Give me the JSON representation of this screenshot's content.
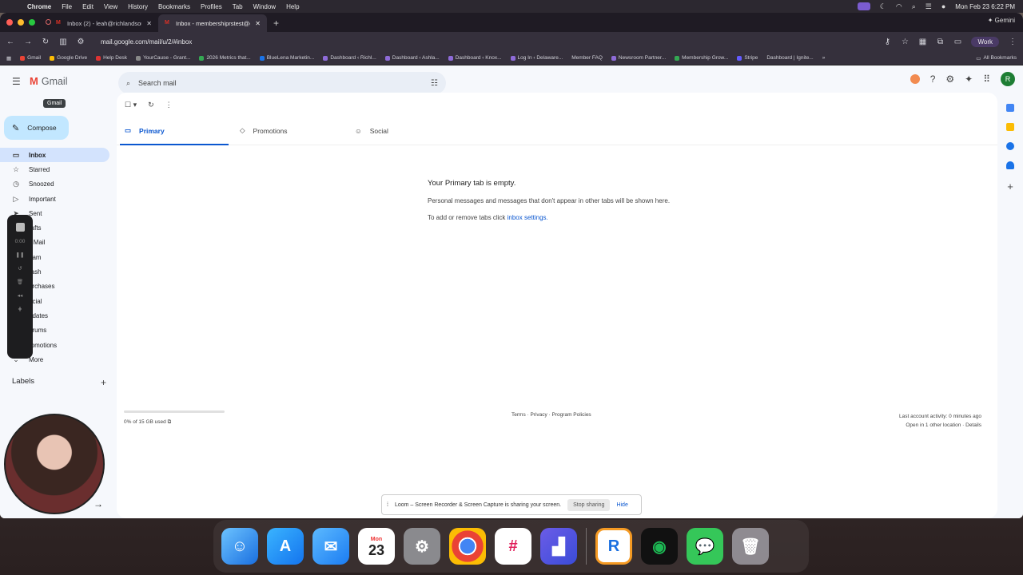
{
  "menubar": {
    "app": "Chrome",
    "menus": [
      "File",
      "Edit",
      "View",
      "History",
      "Bookmarks",
      "Profiles",
      "Tab",
      "Window",
      "Help"
    ],
    "clock": "Mon Feb 23  6:22 PM"
  },
  "browser": {
    "tabs": [
      {
        "title": "Inbox (2) - leah@richlandsou..."
      },
      {
        "title": "Inbox - membershiprstest@g..."
      }
    ],
    "gemini": "Gemini",
    "url": "mail.google.com/mail/u/2/#inbox",
    "profile": "Work",
    "bookmarks": [
      "Gmail",
      "Google Drive",
      "Help Desk",
      "YourCause - Grant...",
      "2026 Metrics that...",
      "BlueLena Marketin...",
      "Dashboard ‹ Richl...",
      "Dashboard ‹ Ashla...",
      "Dashboard ‹ Knox...",
      "Log In ‹ Delaware...",
      "Member FAQ",
      "Newsroom Partner...",
      "Membership Grow...",
      "Stripe",
      "Dashboard | Ignite..."
    ],
    "all_bookmarks": "All Bookmarks"
  },
  "gmail": {
    "logo": "Gmail",
    "tooltip": "Gmail",
    "search_placeholder": "Search mail",
    "compose": "Compose",
    "nav": [
      "Inbox",
      "Starred",
      "Snoozed",
      "Important",
      "Sent",
      "Drafts",
      "All Mail",
      "Spam",
      "Trash",
      "Purchases",
      "Social",
      "Updates",
      "Forums",
      "Promotions",
      "More"
    ],
    "nav_visible": [
      "Inbox",
      "Starred",
      "Snoozed",
      "Important",
      "Sent",
      "rafts",
      "ll Mail",
      "pam",
      "rash",
      "urchases",
      "ocial",
      "pdates",
      "orums",
      "romotions",
      "More"
    ],
    "labels_title": "Labels",
    "loom_timer": "0:00",
    "avatar_letter": "R",
    "tabs": [
      "Primary",
      "Promotions",
      "Social"
    ],
    "empty_title": "Your Primary tab is empty.",
    "empty_body": "Personal messages and messages that don't appear in other tabs will be shown here.",
    "empty_hint": "To add or remove tabs click ",
    "empty_link": "inbox settings.",
    "storage": "0% of 15 GB used",
    "footer": "Terms · Privacy · Program Policies",
    "activity": "Last account activity: 0 minutes ago",
    "activity2": "Open in 1 other location · Details"
  },
  "loom": {
    "message": "Loom – Screen Recorder & Screen Capture is sharing your screen.",
    "stop": "Stop sharing",
    "hide": "Hide"
  },
  "dock": {
    "calendar_month": "Mon",
    "calendar_day": "23"
  }
}
